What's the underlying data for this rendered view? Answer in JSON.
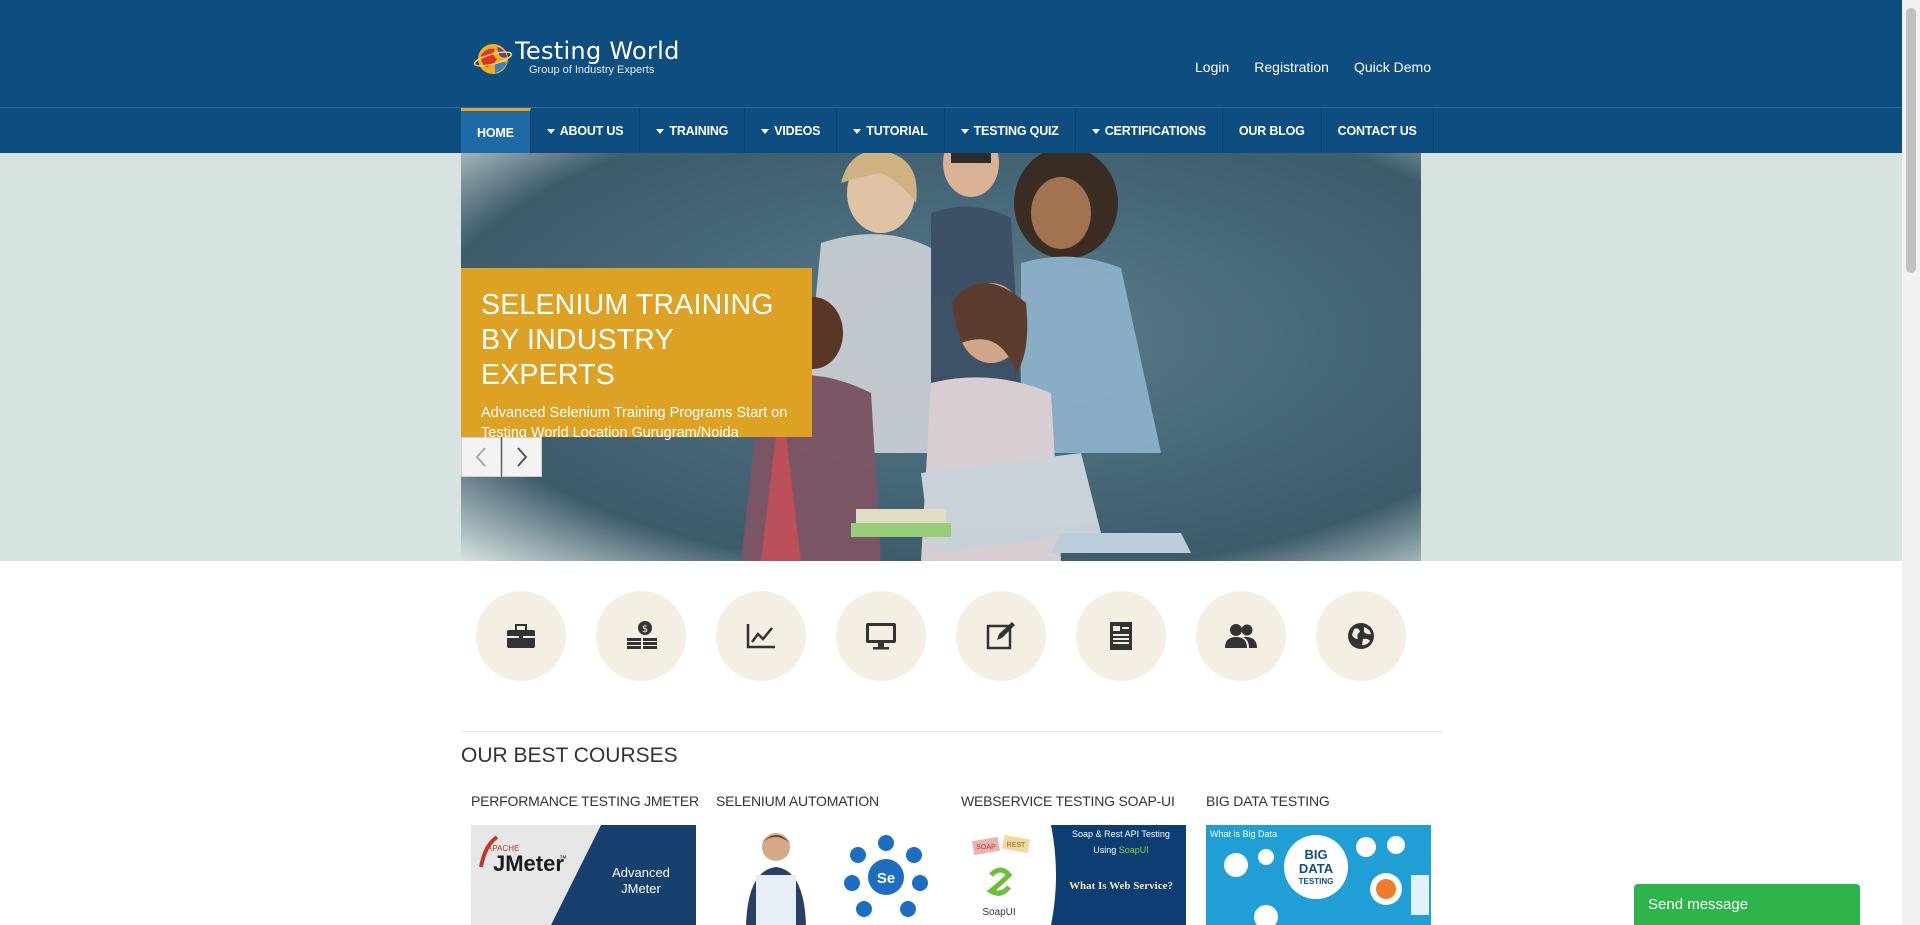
{
  "header": {
    "logo_title": "Testing World",
    "logo_subtitle": "Group of Industry Experts",
    "links": [
      "Login",
      "Registration",
      "Quick Demo"
    ]
  },
  "nav": {
    "items": [
      {
        "label": "HOME",
        "dropdown": false,
        "active": true
      },
      {
        "label": "ABOUT US",
        "dropdown": true
      },
      {
        "label": "TRAINING",
        "dropdown": true
      },
      {
        "label": "VIDEOS",
        "dropdown": true
      },
      {
        "label": "TUTORIAL",
        "dropdown": true
      },
      {
        "label": "TESTING QUIZ",
        "dropdown": true
      },
      {
        "label": "CERTIFICATIONS",
        "dropdown": true
      },
      {
        "label": "OUR BLOG",
        "dropdown": false
      },
      {
        "label": "CONTACT US",
        "dropdown": false
      }
    ]
  },
  "hero": {
    "title_line1": "SELENIUM TRAINING",
    "title_line2": "BY INDUSTRY EXPERTS",
    "text_line1": "Advanced Selenium Training Programs Start on",
    "text_line2": "Testing World Location Gurugram/Noida",
    "caption_color": "#dda224"
  },
  "feature_icons": [
    "briefcase-icon",
    "money-icon",
    "chart-icon",
    "monitor-icon",
    "edit-icon",
    "document-icon",
    "users-icon",
    "globe-icon"
  ],
  "courses": {
    "section_title": "OUR BEST COURSES",
    "items": [
      {
        "title": "PERFORMANCE TESTING JMETER",
        "img_brand": "APACHE",
        "img_name": "JMeter",
        "img_tm": "™",
        "img_caption1": "Advanced",
        "img_caption2": "JMeter"
      },
      {
        "title": "SELENIUM AUTOMATION",
        "img_label": "Se"
      },
      {
        "title": "WEBSERVICE TESTING SOAP-UI",
        "img_tag1": "SOAP",
        "img_tag2": "REST",
        "img_line1": "Soap & Rest API Testing",
        "img_line2_prefix": "Using ",
        "img_line2_highlight": "SoapUI",
        "img_question": "What Is Web Service?",
        "img_logo": "SoapUI"
      },
      {
        "title": "BIG DATA TESTING",
        "img_corner": "What is Big Data",
        "img_big1": "BIG",
        "img_big2": "DATA",
        "img_big3": "TESTING"
      }
    ]
  },
  "chat": {
    "label": "Send message"
  },
  "colors": {
    "header_bg": "#0d4d80",
    "accent": "#e9a321",
    "chat": "#2fb34b"
  }
}
